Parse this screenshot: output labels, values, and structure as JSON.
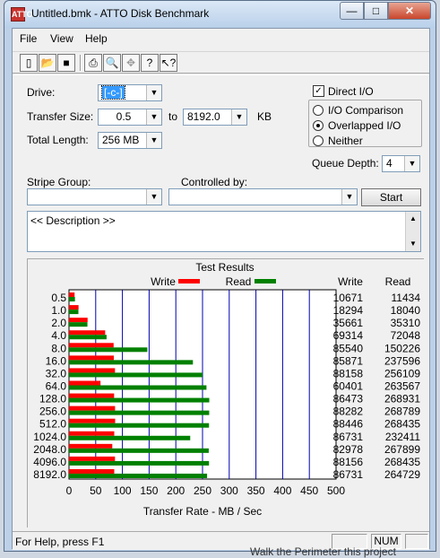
{
  "window": {
    "title": "Untitled.bmk - ATTO Disk Benchmark",
    "app_icon": "ATTO",
    "minimize_glyph": "—",
    "maximize_glyph": "□",
    "close_glyph": "✕"
  },
  "menubar": {
    "items": [
      "File",
      "View",
      "Help"
    ]
  },
  "toolbar": {
    "buttons": [
      "new-document",
      "open-folder",
      "save",
      "print",
      "print-preview",
      "move",
      "help",
      "context-help"
    ]
  },
  "form": {
    "drive_label": "Drive:",
    "drive_value": "[-c-]",
    "transfer_size_label": "Transfer Size:",
    "transfer_from": "0.5",
    "to_label": "to",
    "transfer_to": "8192.0",
    "kb_label": "KB",
    "total_length_label": "Total Length:",
    "total_length_value": "256 MB",
    "direct_io_label": "Direct I/O",
    "direct_io_checked": true,
    "io_comparison_label": "I/O Comparison",
    "overlapped_io_label": "Overlapped I/O",
    "neither_label": "Neither",
    "selected_mode": "Overlapped I/O",
    "queue_depth_label": "Queue Depth:",
    "queue_depth_value": "4",
    "stripe_group_label": "Stripe Group:",
    "stripe_group_value": "",
    "controlled_by_label": "Controlled by:",
    "controlled_by_value": "",
    "start_label": "Start",
    "description_text": "<< Description >>"
  },
  "results": {
    "title": "Test Results",
    "legend_write": "Write",
    "legend_read": "Read",
    "write_color": "#ff0000",
    "read_color": "#008000",
    "col_write": "Write",
    "col_read": "Read"
  },
  "chart_data": {
    "type": "bar",
    "xlabel": "Transfer Rate - MB / Sec",
    "xlim": [
      0,
      500
    ],
    "xticks": [
      "0",
      "50",
      "100",
      "150",
      "200",
      "250",
      "300",
      "350",
      "400",
      "450",
      "500"
    ],
    "categories": [
      "0.5",
      "1.0",
      "2.0",
      "4.0",
      "8.0",
      "16.0",
      "32.0",
      "64.0",
      "128.0",
      "256.0",
      "512.0",
      "1024.0",
      "2048.0",
      "4096.0",
      "8192.0"
    ],
    "series": [
      {
        "name": "Write",
        "values": [
          10671,
          18294,
          35661,
          69314,
          85540,
          85871,
          88158,
          60401,
          86473,
          88282,
          88446,
          86731,
          82978,
          88156,
          86731
        ]
      },
      {
        "name": "Read",
        "values": [
          11434,
          18040,
          35310,
          72048,
          150226,
          237596,
          256109,
          263567,
          268931,
          268789,
          268435,
          232411,
          267899,
          268435,
          264729
        ]
      }
    ]
  },
  "statusbar": {
    "help_text": "For Help, press F1",
    "num_label": "NUM"
  },
  "background": {
    "behind_text": "Walk the Perimeter this project"
  }
}
